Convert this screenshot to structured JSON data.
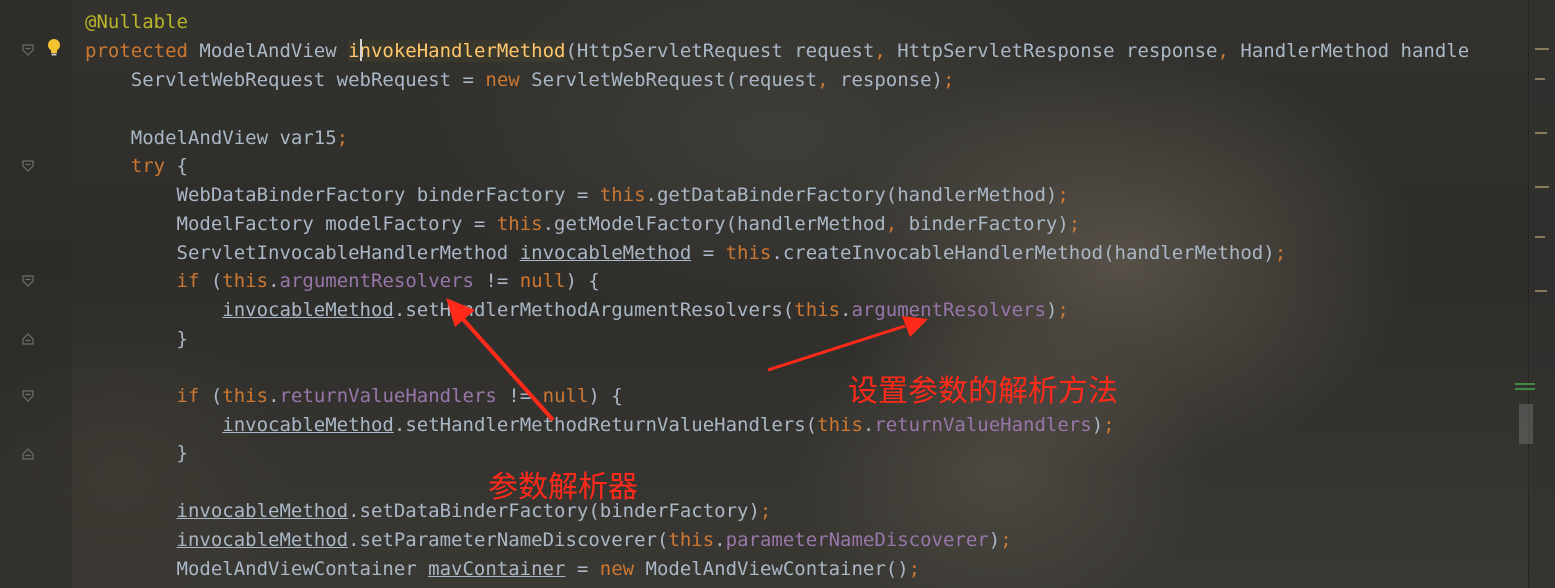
{
  "code": {
    "l1": {
      "annotation": "@Nullable"
    },
    "l2": {
      "kw_protected": "protected",
      "type": " ModelAndView ",
      "method": "invokeHandlerMethod",
      "paren": "(HttpServletRequest request",
      "comma1": ",",
      "p2": " HttpServletResponse response",
      "comma2": ",",
      "p3": " HandlerMethod handle"
    },
    "l3": {
      "a": "    ServletWebRequest webRequest = ",
      "kw_new": "new",
      "b": " ServletWebRequest(request",
      "comma": ",",
      "c": " response)",
      "semi": ";"
    },
    "l5": {
      "a": "    ModelAndView var15",
      "semi": ";"
    },
    "l6": {
      "indent": "    ",
      "kw_try": "try",
      "b": " {"
    },
    "l7": {
      "a": "        WebDataBinderFactory binderFactory = ",
      "kw_this": "this",
      "b": ".getDataBinderFactory(handlerMethod)",
      "semi": ";"
    },
    "l8": {
      "a": "        ModelFactory modelFactory = ",
      "kw_this": "this",
      "b": ".getModelFactory(handlerMethod",
      "comma": ",",
      "c": " binderFactory)",
      "semi": ";"
    },
    "l9": {
      "a": "        ServletInvocableHandlerMethod ",
      "var": "invocableMethod",
      "b": " = ",
      "kw_this": "this",
      "c": ".createInvocableHandlerMethod(handlerMethod)",
      "semi": ";"
    },
    "l10": {
      "indent": "        ",
      "kw_if": "if",
      "a": " (",
      "kw_this": "this",
      "dot": ".",
      "field": "argumentResolvers",
      "b": " != ",
      "kw_null": "null",
      "c": ") {"
    },
    "l11": {
      "indent": "            ",
      "var": "invocableMethod",
      "a": ".setHandlerMethodArgumentResolvers(",
      "kw_this": "this",
      "dot": ".",
      "field": "argumentResolvers",
      "b": ")",
      "semi": ";"
    },
    "l12": {
      "a": "        }"
    },
    "l14": {
      "indent": "        ",
      "kw_if": "if",
      "a": " (",
      "kw_this": "this",
      "dot": ".",
      "field": "returnValueHandlers",
      "b": " != ",
      "kw_null": "null",
      "c": ") {"
    },
    "l15": {
      "indent": "            ",
      "var": "invocableMethod",
      "a": ".setHandlerMethodReturnValueHandlers(",
      "kw_this": "this",
      "dot": ".",
      "field": "returnValueHandlers",
      "b": ")",
      "semi": ";"
    },
    "l16": {
      "a": "        }"
    },
    "l18": {
      "indent": "        ",
      "var": "invocableMethod",
      "a": ".setDataBinderFactory(binderFactory)",
      "semi": ";"
    },
    "l19": {
      "indent": "        ",
      "var": "invocableMethod",
      "a": ".setParameterNameDiscoverer(",
      "kw_this": "this",
      "dot": ".",
      "field": "parameterNameDiscoverer",
      "b": ")",
      "semi": ";"
    },
    "l20": {
      "a": "        ModelAndViewContainer ",
      "var": "mavContainer",
      "b": " = ",
      "kw_new": "new",
      "c": " ModelAndViewContainer()",
      "semi": ";"
    }
  },
  "annotations": {
    "set_param_parser": "设置参数的解析方法",
    "param_resolver": "参数解析器"
  },
  "icons": {
    "bulb": "lightbulb-icon",
    "fold": "fold-marker-icon"
  },
  "colors": {
    "keyword": "#cc7832",
    "annotation": "#bbb529",
    "field": "#9876aa",
    "method_decl": "#ffc66d",
    "text": "#a9b7c6",
    "markup_red": "#ff2a1a"
  }
}
